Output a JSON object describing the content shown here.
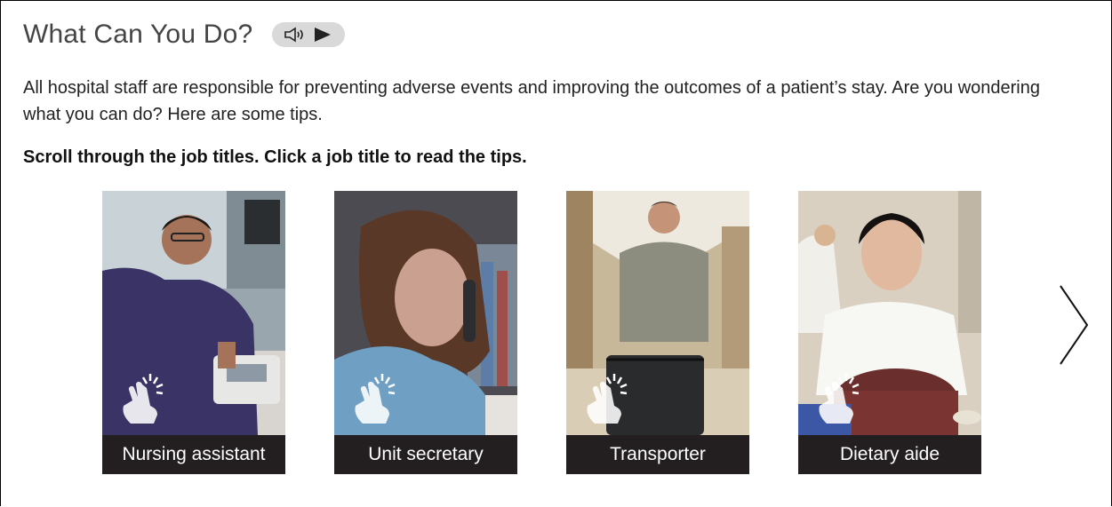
{
  "header": {
    "title": "What Can You Do?",
    "audio_button_icon": "speaker-play-icon"
  },
  "intro_text": "All hospital staff are responsible for preventing adverse events and improving the outcomes of a patient’s stay. Are you wondering what you can do? Here are some tips.",
  "instruction": "Scroll through the job titles. Click a job title to read the tips.",
  "cards": [
    {
      "label": "Nursing assistant",
      "icon": "tap-hand-icon"
    },
    {
      "label": "Unit secretary",
      "icon": "tap-hand-icon"
    },
    {
      "label": "Transporter",
      "icon": "tap-hand-icon"
    },
    {
      "label": "Dietary aide",
      "icon": "tap-hand-icon"
    }
  ],
  "carousel": {
    "next_icon": "chevron-right-icon"
  },
  "colors": {
    "label_bg": "#231f20",
    "label_text": "#ffffff",
    "audio_bg": "#d9d9d9"
  }
}
